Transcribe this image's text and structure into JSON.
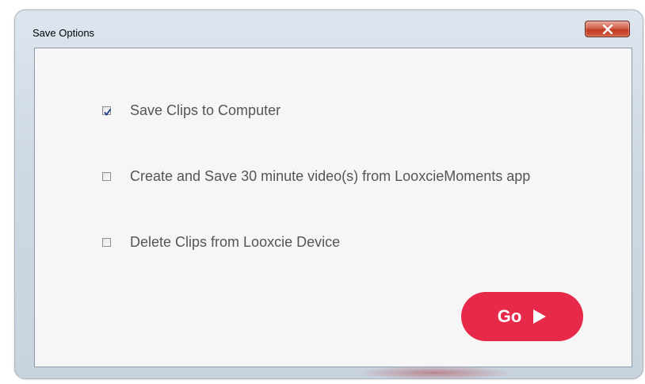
{
  "window": {
    "title": "Save Options",
    "close_icon": "close-x-icon"
  },
  "options": [
    {
      "label": "Save Clips to Computer",
      "checked": true
    },
    {
      "label": "Create and Save 30 minute video(s) from LooxcieMoments app",
      "checked": false
    },
    {
      "label": "Delete Clips from Looxcie Device",
      "checked": false
    }
  ],
  "actions": {
    "go_label": "Go",
    "go_icon": "play-arrow-icon"
  },
  "colors": {
    "accent": "#e7294a",
    "close_button": "#c13a24",
    "text": "#555555",
    "background": "#f6f6f6"
  }
}
